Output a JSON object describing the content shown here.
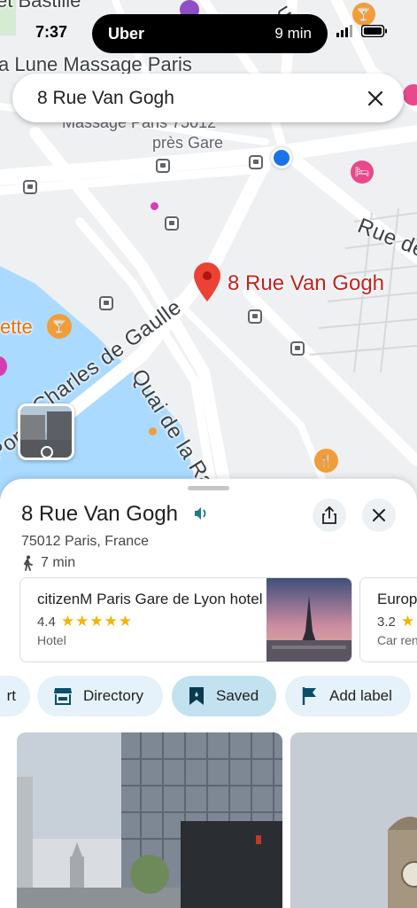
{
  "status_bar": {
    "time": "7:37",
    "live_app": "Uber",
    "live_eta": "9 min"
  },
  "search": {
    "value": "8 Rue Van Gogh"
  },
  "map": {
    "labels": {
      "bastille": "et Bastille",
      "sumat": "umat",
      "massage_1": "a Lune Massage Paris",
      "massage_2": "Massage Paris 75012",
      "pres_gare": "près Gare",
      "rue_de": "Rue de",
      "charles_de_gaulle": "Charles de Gaulle",
      "quai_de_la_rap": "Quai de la Rap",
      "pont": "Pont",
      "ette": "ette",
      "pin": "8 Rue Van Gogh"
    },
    "colors": {
      "water": "#aadaff",
      "road": "#ffffff",
      "pin": "#ea4335",
      "location": "#1a73e8",
      "food_poi": "#e8710a",
      "hotel_poi": "#e64a8c"
    }
  },
  "place": {
    "title": "8 Rue Van Gogh",
    "address": "75012 Paris, France",
    "walk_time": "7 min"
  },
  "nearby": [
    {
      "name": "citizenM Paris Gare de Lyon hotel",
      "rating": "4.4",
      "stars": "★★★★★",
      "type": "Hotel"
    },
    {
      "name": "Europ",
      "rating": "3.2",
      "stars": "★",
      "type": "Car ren"
    }
  ],
  "chips": [
    {
      "label": "rt",
      "icon": ""
    },
    {
      "label": "Directory",
      "icon": "storefront-icon"
    },
    {
      "label": "Saved",
      "icon": "bookmark-icon"
    },
    {
      "label": "Add label",
      "icon": "flag-icon"
    }
  ]
}
